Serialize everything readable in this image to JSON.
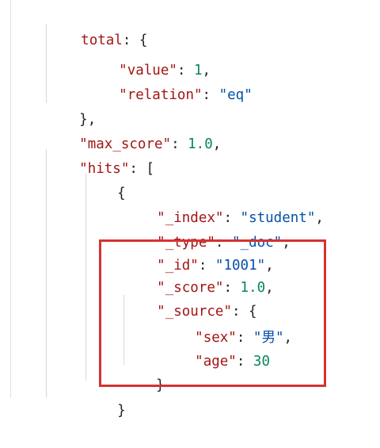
{
  "lines": {
    "total_key": "total",
    "total_rest": ": {",
    "value_key": "\"value\"",
    "value_val": "1",
    "relation_key": "\"relation\"",
    "relation_val": "\"eq\"",
    "close_total": "},",
    "max_score_key": "\"max_score\"",
    "max_score_val": "1.0",
    "hits_key": "\"hits\"",
    "hits_rest": ": [",
    "hit_open": "{",
    "index_key": "\"_index\"",
    "index_val": "\"student\"",
    "type_key": "\"_type\"",
    "type_val": "\"_doc\"",
    "id_key": "\"_id\"",
    "id_val": "\"1001\"",
    "score_key": "\"_score\"",
    "score_val": "1.0",
    "source_key": "\"_source\"",
    "source_rest": ": {",
    "sex_key": "\"sex\"",
    "sex_val": "\"男\"",
    "age_key": "\"age\"",
    "age_val": "30",
    "source_close": "}",
    "hit_close": "}"
  },
  "colors": {
    "key": "#a31515",
    "string": "#0451a5",
    "number": "#098658",
    "highlight_border": "#d63232"
  }
}
